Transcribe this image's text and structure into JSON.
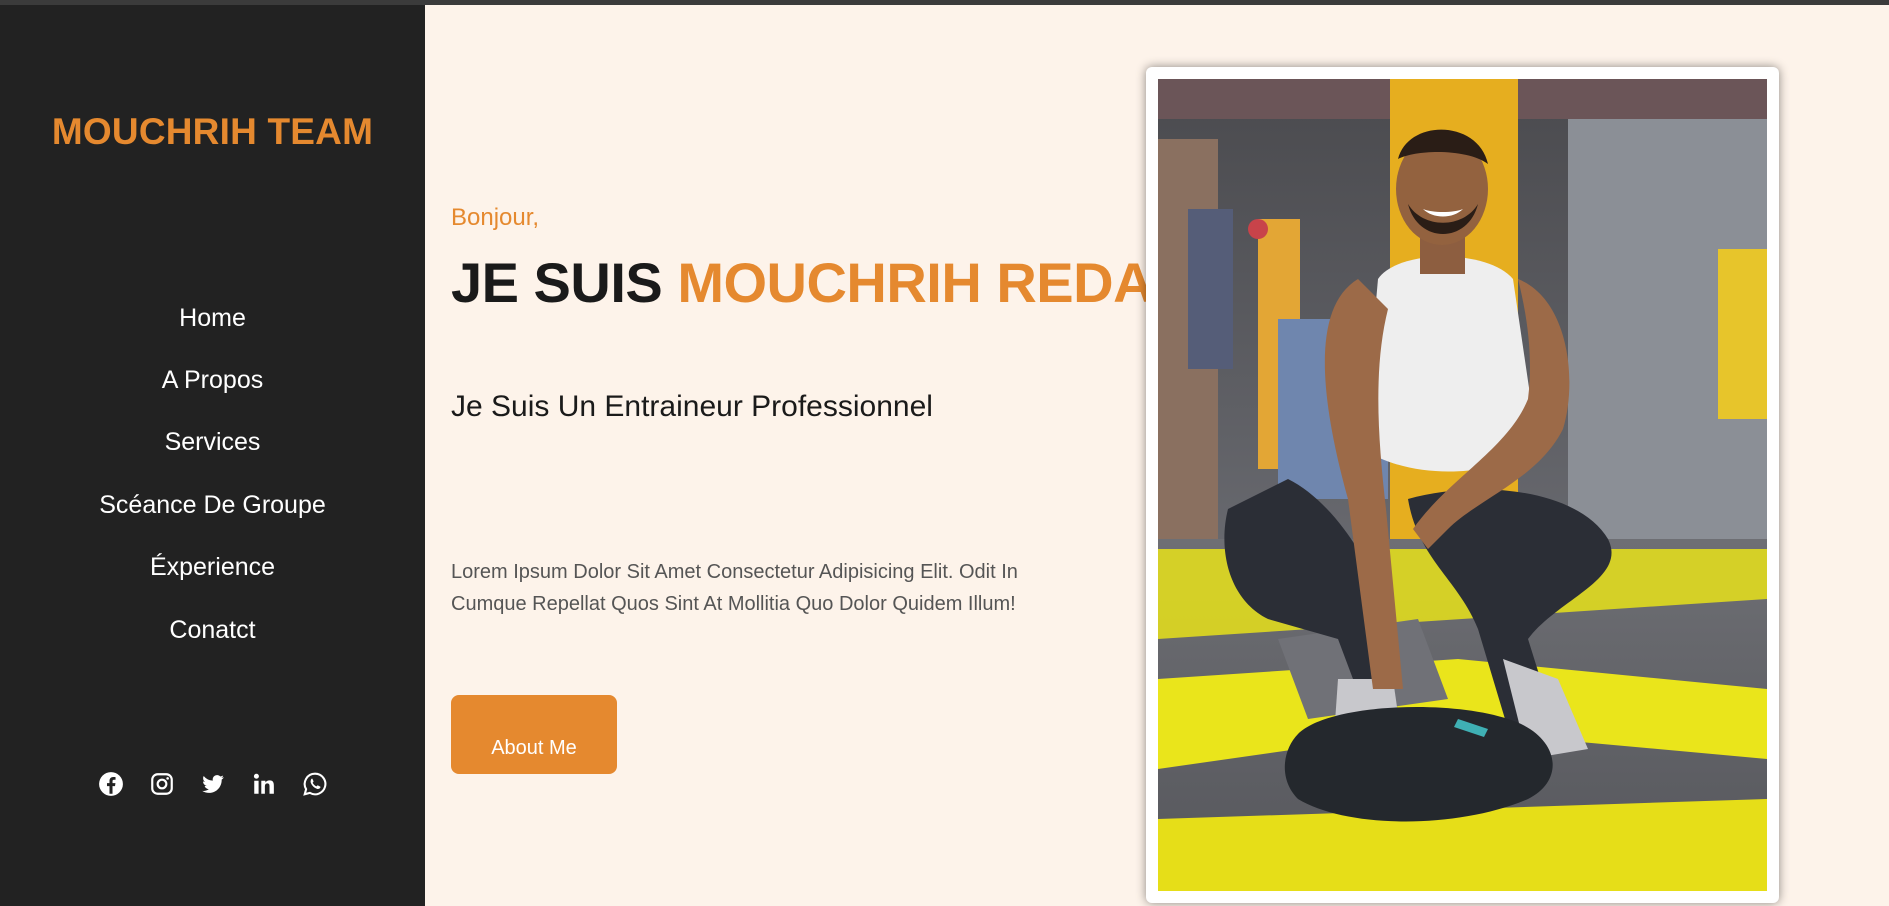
{
  "brand": {
    "name": "MOUCHRIH TEAM",
    "accent_color": "#e5892f"
  },
  "nav": {
    "items": [
      {
        "label": "Home"
      },
      {
        "label": "A Propos"
      },
      {
        "label": "Services"
      },
      {
        "label": "Scéance De Groupe"
      },
      {
        "label": "Éxperience"
      },
      {
        "label": "Conatct"
      }
    ]
  },
  "social": {
    "icons": [
      "facebook-icon",
      "instagram-icon",
      "twitter-icon",
      "linkedin-icon",
      "whatsapp-icon"
    ]
  },
  "hero": {
    "greeting": "Bonjour,",
    "headline_prefix": "JE SUIS ",
    "headline_name": "MOUCHRIH REDA",
    "subtitle": "Je Suis Un Entraineur Professionnel",
    "description": "Lorem Ipsum Dolor Sit Amet Consectetur Adipisicing Elit. Odit In Cumque Repellat Quos Sint At Mollitia Quo Dolor Quidem Illum!",
    "button_label": "About Me"
  }
}
